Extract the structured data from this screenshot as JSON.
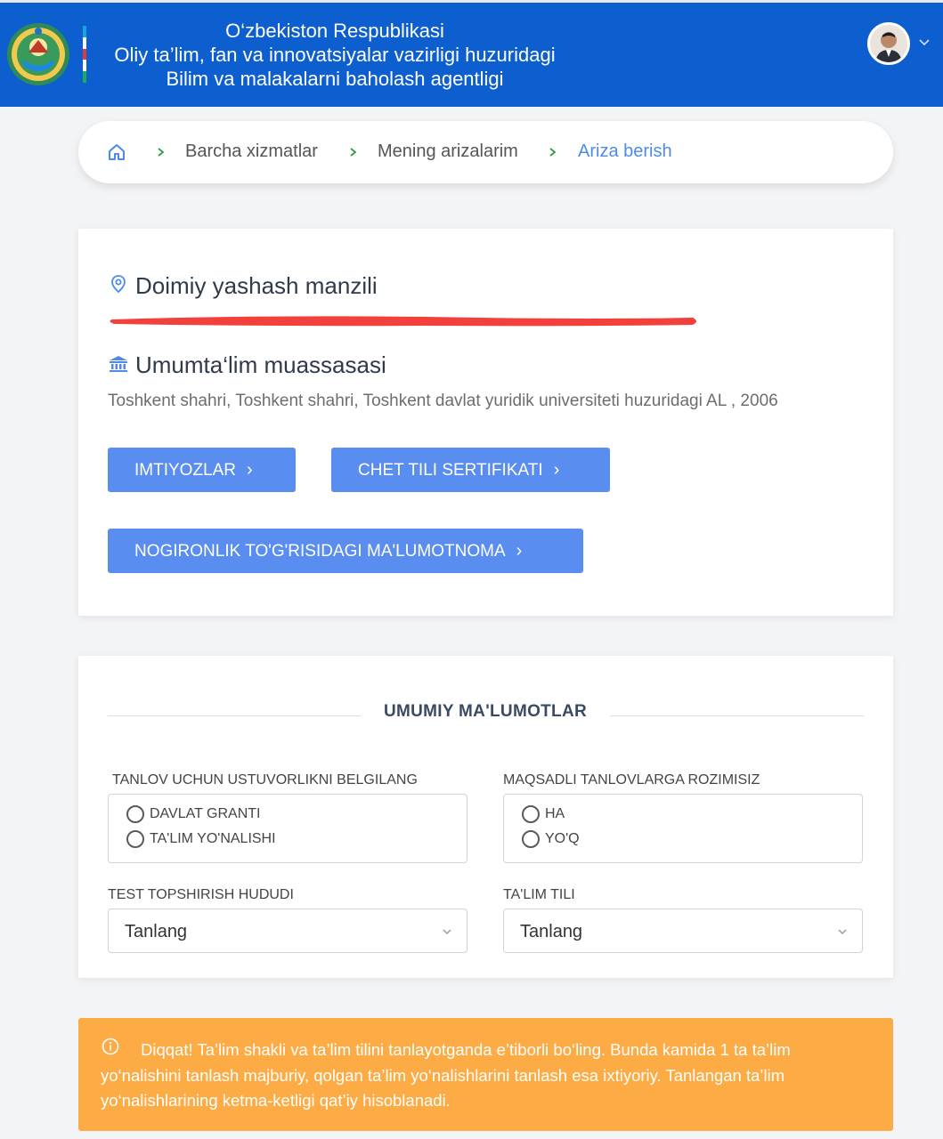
{
  "header": {
    "title_lines": [
      "O‘zbekiston Respublikasi",
      "Oliy ta’lim, fan va innovatsiyalar vazirligi huzuridagi",
      "Bilim va malakalarni baholash agentligi"
    ],
    "colors": {
      "bar": "#0d5fcf",
      "flag": [
        "#1aa3e0",
        "#ffffff",
        "#e03a3a",
        "#ffffff",
        "#1bae5a"
      ]
    }
  },
  "breadcrumb": {
    "items": [
      "Barcha xizmatlar",
      "Mening arizalarim",
      "Ariza berish"
    ]
  },
  "address_card": {
    "residence_title": "Doimiy yashash manzili",
    "school_title": "Umumta‘lim muassasasi",
    "school_value": "Toshkent shahri, Toshkent shahri, Toshkent davlat yuridik universiteti huzuridagi AL , 2006",
    "buttons": {
      "privileges": "IMTIYOZLAR",
      "certificate": "CHET TILI SERTIFIKATI",
      "disability": "NOGIRONLIK TO'G'RISIDAGI MA'LUMOTNOMA"
    }
  },
  "general_info": {
    "heading": "UMUMIY MA'LUMOTLAR",
    "priority": {
      "label": "TANLOV UCHUN USTUVORLIKNI BELGILANG",
      "options": [
        "DAVLAT GRANTI",
        "TA'LIM YO'NALISHI"
      ]
    },
    "targeted": {
      "label": "MAQSADLI TANLOVLARGA ROZIMISIZ",
      "options": [
        "HA",
        "YO'Q"
      ]
    },
    "test_region": {
      "label": "TEST TOPSHIRISH HUDUDI",
      "value": "Tanlang"
    },
    "language": {
      "label": "TA'LIM TILI",
      "value": "Tanlang"
    }
  },
  "alert": {
    "text": "Diqqat! Ta’lim shakli va ta’lim tilini tanlayotganda e’tiborli bo‘ling. Bunda kamida 1 ta ta’lim yo‘nalishini tanlash majburiy, qolgan ta’lim yo‘nalishlarini tanlash esa ixtiyoriy. Tanlangan ta’lim yo‘nalishlarining ketma-ketligi qat’iy hisoblanadi.",
    "color": "#fcab45"
  }
}
